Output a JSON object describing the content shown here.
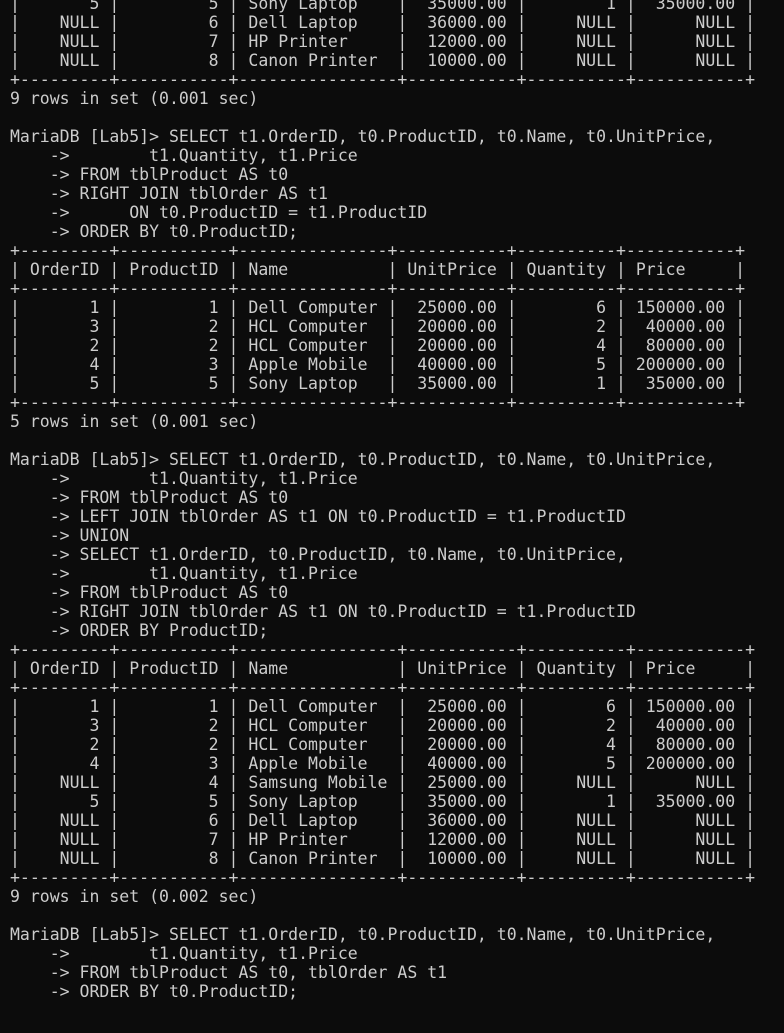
{
  "terminal": {
    "lines": [
      "|       5 |         5 | Sony Laptop    |  35000.00 |        1 |  35000.00 |",
      "|    NULL |         6 | Dell Laptop    |  36000.00 |     NULL |      NULL |",
      "|    NULL |         7 | HP Printer     |  12000.00 |     NULL |      NULL |",
      "|    NULL |         8 | Canon Printer  |  10000.00 |     NULL |      NULL |",
      "+---------+-----------+----------------+-----------+----------+-----------+",
      "9 rows in set (0.001 sec)",
      "",
      "MariaDB [Lab5]> SELECT t1.OrderID, t0.ProductID, t0.Name, t0.UnitPrice,",
      "    ->        t1.Quantity, t1.Price",
      "    -> FROM tblProduct AS t0",
      "    -> RIGHT JOIN tblOrder AS t1",
      "    ->      ON t0.ProductID = t1.ProductID",
      "    -> ORDER BY t0.ProductID;",
      "+---------+-----------+---------------+-----------+----------+-----------+",
      "| OrderID | ProductID | Name          | UnitPrice | Quantity | Price     |",
      "+---------+-----------+---------------+-----------+----------+-----------+",
      "|       1 |         1 | Dell Computer |  25000.00 |        6 | 150000.00 |",
      "|       3 |         2 | HCL Computer  |  20000.00 |        2 |  40000.00 |",
      "|       2 |         2 | HCL Computer  |  20000.00 |        4 |  80000.00 |",
      "|       4 |         3 | Apple Mobile  |  40000.00 |        5 | 200000.00 |",
      "|       5 |         5 | Sony Laptop   |  35000.00 |        1 |  35000.00 |",
      "+---------+-----------+---------------+-----------+----------+-----------+",
      "5 rows in set (0.001 sec)",
      "",
      "MariaDB [Lab5]> SELECT t1.OrderID, t0.ProductID, t0.Name, t0.UnitPrice,",
      "    ->        t1.Quantity, t1.Price",
      "    -> FROM tblProduct AS t0",
      "    -> LEFT JOIN tblOrder AS t1 ON t0.ProductID = t1.ProductID",
      "    -> UNION",
      "    -> SELECT t1.OrderID, t0.ProductID, t0.Name, t0.UnitPrice,",
      "    ->        t1.Quantity, t1.Price",
      "    -> FROM tblProduct AS t0",
      "    -> RIGHT JOIN tblOrder AS t1 ON t0.ProductID = t1.ProductID",
      "    -> ORDER BY ProductID;",
      "+---------+-----------+----------------+-----------+----------+-----------+",
      "| OrderID | ProductID | Name           | UnitPrice | Quantity | Price     |",
      "+---------+-----------+----------------+-----------+----------+-----------+",
      "|       1 |         1 | Dell Computer  |  25000.00 |        6 | 150000.00 |",
      "|       3 |         2 | HCL Computer   |  20000.00 |        2 |  40000.00 |",
      "|       2 |         2 | HCL Computer   |  20000.00 |        4 |  80000.00 |",
      "|       4 |         3 | Apple Mobile   |  40000.00 |        5 | 200000.00 |",
      "|    NULL |         4 | Samsung Mobile |  25000.00 |     NULL |      NULL |",
      "|       5 |         5 | Sony Laptop    |  35000.00 |        1 |  35000.00 |",
      "|    NULL |         6 | Dell Laptop    |  36000.00 |     NULL |      NULL |",
      "|    NULL |         7 | HP Printer     |  12000.00 |     NULL |      NULL |",
      "|    NULL |         8 | Canon Printer  |  10000.00 |     NULL |      NULL |",
      "+---------+-----------+----------------+-----------+----------+-----------+",
      "9 rows in set (0.002 sec)",
      "",
      "MariaDB [Lab5]> SELECT t1.OrderID, t0.ProductID, t0.Name, t0.UnitPrice,",
      "    ->        t1.Quantity, t1.Price",
      "    -> FROM tblProduct AS t0, tblOrder AS t1",
      "    -> ORDER BY t0.ProductID;"
    ]
  }
}
